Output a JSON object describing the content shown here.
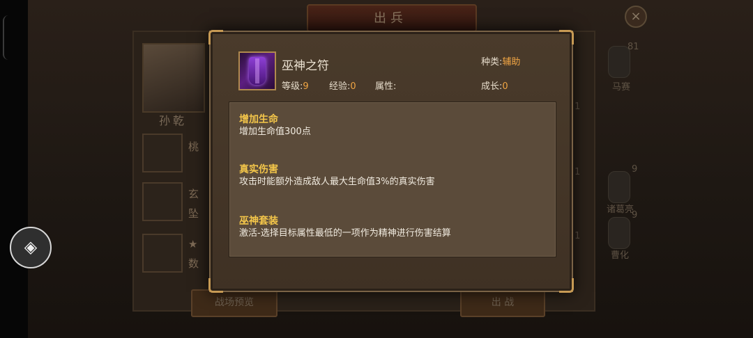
{
  "background": {
    "title": "出兵",
    "close_glyph": "×",
    "hero_name": "孙乾",
    "slot_texts": [
      "桃",
      "玄",
      "★"
    ],
    "slot_subtexts": [
      "",
      "坠",
      "数"
    ],
    "right_labels": [
      "马赛",
      "诸葛亮",
      "曹化"
    ],
    "right_numbers": [
      "81",
      "1",
      "1",
      "9",
      "9",
      "1"
    ],
    "buttons": [
      "战场预览",
      "出 战"
    ]
  },
  "side_button": {
    "icon": "layers-icon",
    "glyph": "◈"
  },
  "popup": {
    "item": {
      "name": "巫神之符",
      "icon": "purple-cape-talisman-icon",
      "type_label": "种类",
      "type_value": "辅助",
      "level_label": "等级",
      "level_value": "9",
      "exp_label": "经验",
      "exp_value": "0",
      "attr_label": "属性",
      "attr_value": "",
      "growth_label": "成长",
      "growth_value": "0",
      "separator": ":"
    },
    "skills": [
      {
        "title": "增加生命",
        "text": "增加生命值300点"
      },
      {
        "title": "真实伤害",
        "text": "攻击时能额外造成敌人最大生命值3%的真实伤害"
      },
      {
        "title": "巫神套装",
        "text": "激活-选择目标属性最低的一项作为精神进行伤害结算"
      }
    ]
  },
  "colors": {
    "value_accent": "#f0a544",
    "skill_title": "#f4c64a",
    "popup_bg": "#4a3b2b",
    "frame_gold": "#c79a54"
  }
}
